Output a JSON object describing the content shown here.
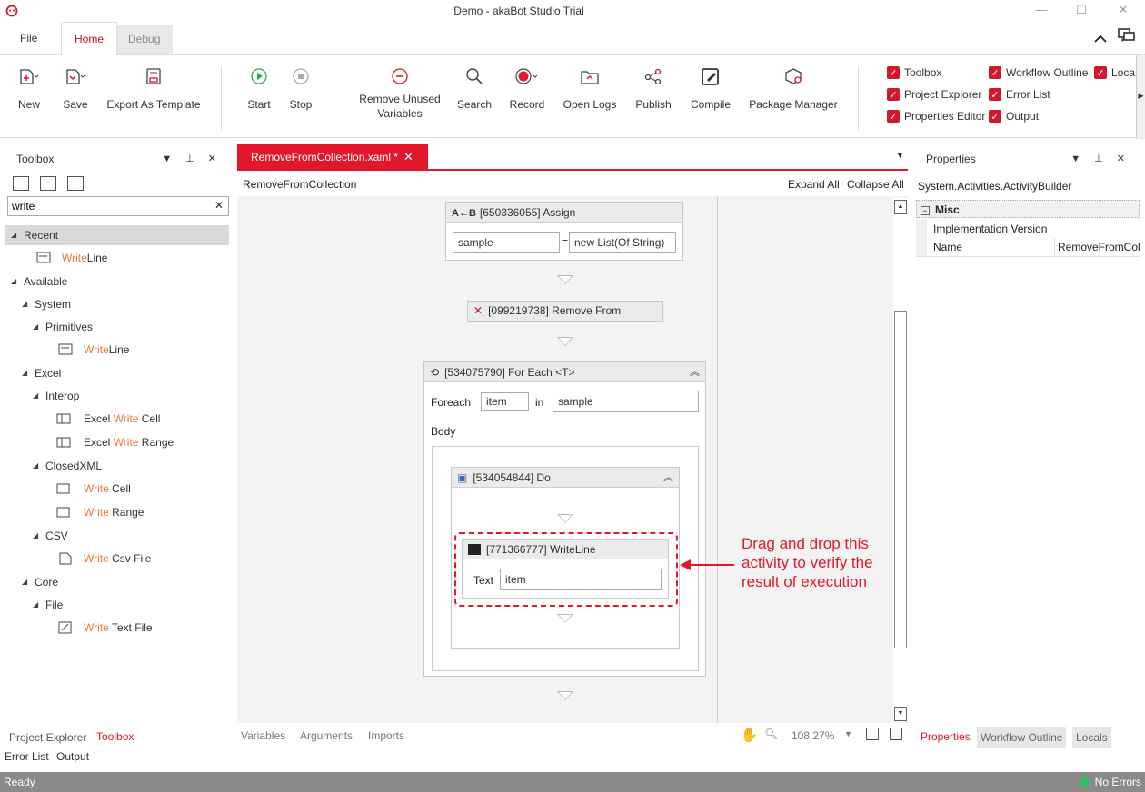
{
  "window": {
    "title": "Demo - akaBot Studio Trial"
  },
  "tabs": {
    "file": "File",
    "home": "Home",
    "debug": "Debug"
  },
  "ribbon": {
    "buttons": [
      "New",
      "Save",
      "Export As Template",
      "Start",
      "Stop",
      "Remove Unused",
      "Variables",
      "Search",
      "Record",
      "Open Logs",
      "Publish",
      "Compile",
      "Package Manager"
    ],
    "panes": [
      "Toolbox",
      "Workflow Outline",
      "Loca",
      "Project Explorer",
      "Error List",
      "Properties Editor",
      "Output"
    ]
  },
  "toolbox": {
    "title": "Toolbox",
    "search_value": "write",
    "tree": [
      {
        "pre": "",
        "hl": "",
        "post": "Recent"
      },
      {
        "pre": "",
        "hl": "Write",
        "post": "Line"
      },
      {
        "pre": "",
        "hl": "",
        "post": "Available"
      },
      {
        "pre": "",
        "hl": "",
        "post": "System"
      },
      {
        "pre": "",
        "hl": "",
        "post": "Primitives"
      },
      {
        "pre": "",
        "hl": "Write",
        "post": "Line"
      },
      {
        "pre": "",
        "hl": "",
        "post": "Excel"
      },
      {
        "pre": "",
        "hl": "",
        "post": "Interop"
      },
      {
        "pre": "Excel ",
        "hl": "Write",
        "post": " Cell"
      },
      {
        "pre": "Excel ",
        "hl": "Write",
        "post": " Range"
      },
      {
        "pre": "",
        "hl": "",
        "post": "ClosedXML"
      },
      {
        "pre": "",
        "hl": "Write",
        "post": " Cell"
      },
      {
        "pre": "",
        "hl": "Write",
        "post": " Range"
      },
      {
        "pre": "",
        "hl": "",
        "post": "CSV"
      },
      {
        "pre": "",
        "hl": "Write",
        "post": " Csv File"
      },
      {
        "pre": "",
        "hl": "",
        "post": "Core"
      },
      {
        "pre": "",
        "hl": "",
        "post": "File"
      },
      {
        "pre": "",
        "hl": "Write",
        "post": " Text File"
      }
    ],
    "bottom_tabs": [
      "Project Explorer",
      "Toolbox"
    ]
  },
  "bottom_panels": [
    "Error List",
    "Output"
  ],
  "designer": {
    "tab_title": "RemoveFromCollection.xaml *",
    "breadcrumb": "RemoveFromCollection",
    "expand_all": "Expand All",
    "collapse_all": "Collapse All",
    "assign": {
      "title": "[650336055] Assign",
      "left": "sample",
      "eq": "=",
      "right": "new List(Of String)"
    },
    "remove": {
      "title": "[099219738] Remove From"
    },
    "foreach": {
      "title": "[534075790] For Each <T>",
      "foreach_label": "Foreach",
      "item": "item",
      "in_label": "in",
      "collection": "sample",
      "body_label": "Body"
    },
    "do": {
      "title": "[534054844] Do"
    },
    "writeline": {
      "title": "[771366777] WriteLine",
      "text_label": "Text",
      "text_value": "item"
    },
    "footer_tabs": [
      "Variables",
      "Arguments",
      "Imports"
    ],
    "zoom": "108.27%"
  },
  "annotation": "Drag and drop this activity to verify the result of execution",
  "properties": {
    "title": "Properties",
    "object": "System.Activities.ActivityBuilder",
    "category": "Misc",
    "rows": [
      {
        "name": "Implementation Version",
        "value": ""
      },
      {
        "name": "Name",
        "value": "RemoveFromCol"
      }
    ],
    "bottom_tabs": [
      "Properties",
      "Workflow Outline",
      "Locals"
    ]
  },
  "status": {
    "left": "Ready",
    "right": "No Errors"
  },
  "colors": {
    "accent": "#e3172b",
    "highlight": "#e8783a",
    "status_ok": "#22c55e"
  }
}
